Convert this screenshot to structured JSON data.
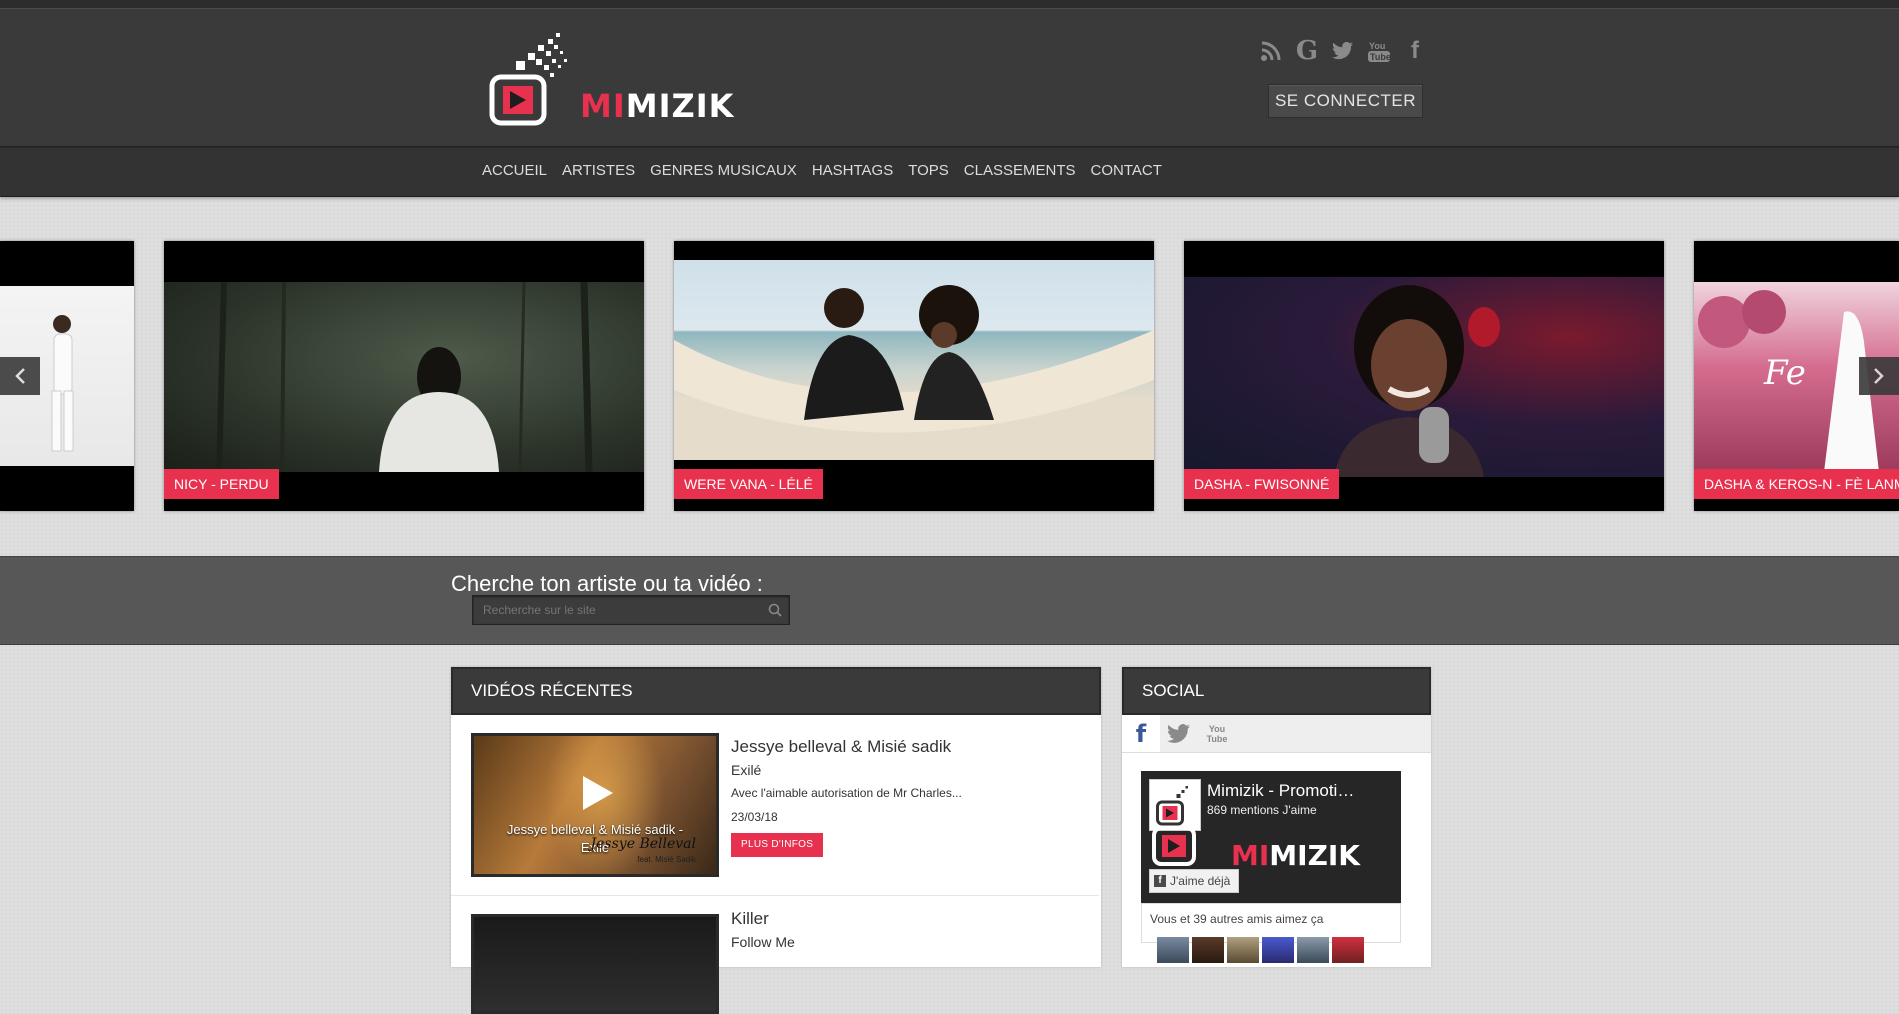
{
  "header": {
    "logo_text_red": "MI",
    "logo_text_white": "MIZIK",
    "social_icons": [
      "rss-icon",
      "google-icon",
      "twitter-icon",
      "youtube-icon",
      "facebook-icon"
    ],
    "login_label": "SE CONNECTER"
  },
  "nav": {
    "items": [
      "ACCUEIL",
      "ARTISTES",
      "GENRES MUSICAUX",
      "HASHTAGS",
      "TOPS",
      "CLASSEMENTS",
      "CONTACT"
    ]
  },
  "slider": {
    "slides": [
      {
        "caption": ""
      },
      {
        "caption": "NICY - PERDU"
      },
      {
        "caption": "WERE VANA - LÉLÉ"
      },
      {
        "caption": "DASHA - FWISONNÉ"
      },
      {
        "caption": "DASHA & KEROS-N - FÈ LANM"
      }
    ]
  },
  "search": {
    "title": "Cherche ton artiste ou ta vidéo :",
    "placeholder": "Recherche sur le site"
  },
  "recent": {
    "title": "VIDÉOS RÉCENTES",
    "items": [
      {
        "artist": "Jessye belleval & Misié sadik",
        "song": "Exilé",
        "desc": "Avec l'aimable autorisation de Mr Charles...",
        "date": "23/03/18",
        "button": "PLUS D'INFOS",
        "thumb_caption_line1": "Jessye belleval & Misié sadik -",
        "thumb_caption_line2": "Exilé",
        "thumb_watermark": "Jessye Belleval",
        "thumb_watermark_small": "feat. Misié Sadik"
      },
      {
        "artist": "Killer",
        "song": "Follow Me"
      }
    ]
  },
  "social": {
    "title": "SOCIAL",
    "tabs": [
      "facebook-icon",
      "twitter-icon",
      "youtube-icon"
    ],
    "tab_youtube_text": "You Tube",
    "fb_page_name": "Mimizik - Promoti…",
    "fb_likes": "869 mentions J'aime",
    "fb_like_button": "J'aime déjà",
    "fb_friends": "Vous et 39 autres amis aimez ça",
    "fb_logo_red": "MI",
    "fb_logo_white": "MIZIK"
  },
  "colors": {
    "accent": "#e8304f",
    "header_bg": "#3a3a3a",
    "page_bg": "#dedede"
  }
}
